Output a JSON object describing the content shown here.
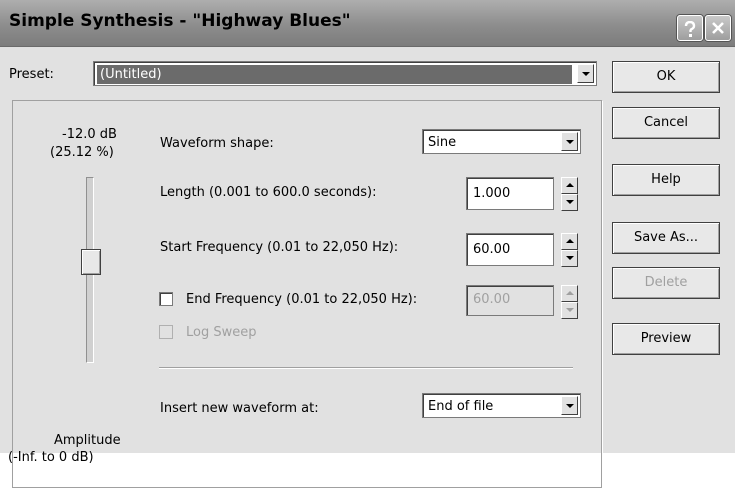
{
  "window": {
    "title": "Simple Synthesis - \"Highway Blues\""
  },
  "preset": {
    "label": "Preset:",
    "value": "(Untitled)"
  },
  "amplitude": {
    "db_readout": "-12.0 dB",
    "percent_readout": "(25.12 %)",
    "label": "Amplitude",
    "range": "(-Inf. to 0 dB)",
    "slider_level_fraction": 0.55
  },
  "waveform": {
    "label": "Waveform shape:",
    "value": "Sine"
  },
  "length": {
    "label": "Length (0.001 to 600.0 seconds):",
    "value": "1.000"
  },
  "start_freq": {
    "label": "Start Frequency (0.01 to 22,050 Hz):",
    "value": "60.00"
  },
  "end_freq": {
    "label": "End Frequency (0.01 to 22,050 Hz):",
    "value": "60.00",
    "checked": false
  },
  "log_sweep": {
    "label": "Log Sweep",
    "checked": false,
    "enabled": false
  },
  "insert": {
    "label": "Insert new waveform at:",
    "value": "End of file"
  },
  "buttons": {
    "ok": "OK",
    "cancel": "Cancel",
    "help": "Help",
    "save_as": "Save As...",
    "delete": "Delete",
    "preview": "Preview"
  },
  "titlebar_buttons": {
    "help_icon": "question-mark-icon",
    "close_icon": "close-x-icon"
  }
}
